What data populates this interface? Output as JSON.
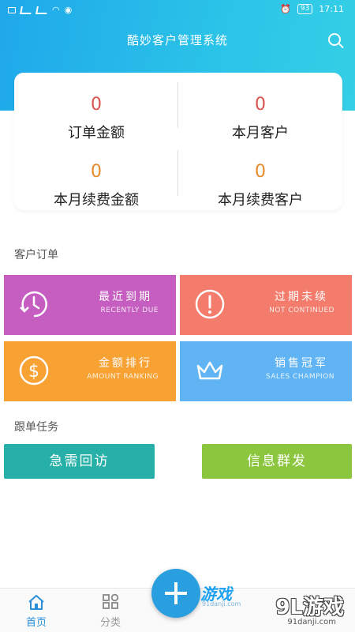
{
  "status": {
    "battery": "93",
    "time": "17:11"
  },
  "header": {
    "title": "酷妙客户管理系统"
  },
  "stats": [
    {
      "value": "0",
      "label": "订单金额"
    },
    {
      "value": "0",
      "label": "本月客户"
    },
    {
      "value": "0",
      "label": "本月续费金额"
    },
    {
      "value": "0",
      "label": "本月续费客户"
    }
  ],
  "sections": {
    "orders": "客户订单",
    "tasks": "跟单任务"
  },
  "tiles": [
    {
      "cn": "最近到期",
      "en": "RECENTLY DUE",
      "color": "#c55ec0",
      "icon": "clock-icon"
    },
    {
      "cn": "过期未续",
      "en": "NOT CONTINUED",
      "color": "#f47c6c",
      "icon": "alert-icon"
    },
    {
      "cn": "金额排行",
      "en": "AMOUNT RANKING",
      "color": "#f9a234",
      "icon": "dollar-icon"
    },
    {
      "cn": "销售冠军",
      "en": "SALES CHAMPION",
      "color": "#60b4f4",
      "icon": "crown-icon"
    }
  ],
  "buttons": [
    {
      "label": "急需回访",
      "color": "#26b0a8"
    },
    {
      "label": "信息群发",
      "color": "#8cc63f"
    }
  ],
  "tabbar": {
    "home": "首页",
    "category": "分类",
    "active_color": "#2a8fd8"
  },
  "watermark": {
    "small": "游戏",
    "small_sub": "91danji.com",
    "big": "9L游戏",
    "big_sub": "91danji.com"
  }
}
